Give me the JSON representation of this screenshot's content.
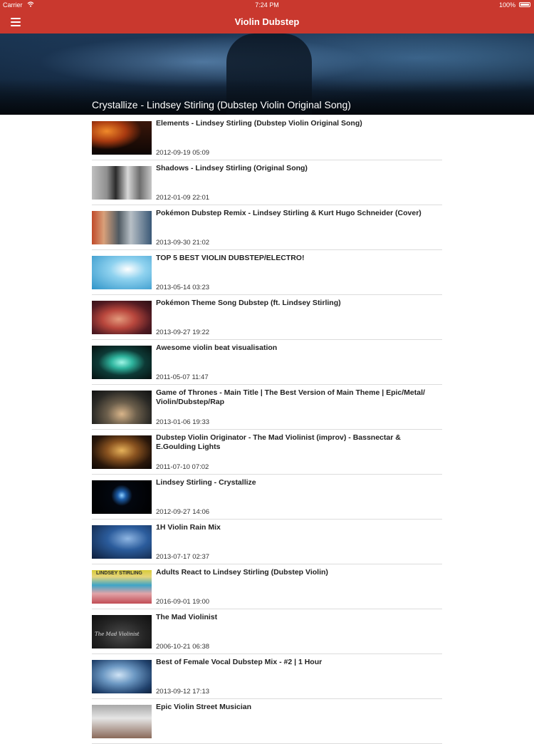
{
  "status_bar": {
    "carrier": "Carrier",
    "time": "7:24 PM",
    "battery": "100%"
  },
  "nav": {
    "title": "Violin Dubstep",
    "menu_icon": "hamburger-menu-icon"
  },
  "featured": {
    "title": "Crystallize - Lindsey Stirling (Dubstep Violin Original Song)"
  },
  "videos": [
    {
      "title": "Elements - Lindsey Stirling (Dubstep Violin Original Song)",
      "date": "2012-09-19 05:09"
    },
    {
      "title": "Shadows - Lindsey Stirling (Original Song)",
      "date": "2012-01-09 22:01"
    },
    {
      "title": "Pokémon Dubstep Remix - Lindsey Stirling & Kurt Hugo Schneider (Cover)",
      "date": "2013-09-30 21:02"
    },
    {
      "title": "TOP 5 BEST VIOLIN DUBSTEP/ELECTRO!",
      "date": "2013-05-14 03:23"
    },
    {
      "title": "Pokémon Theme Song Dubstep (ft. Lindsey Stirling)",
      "date": "2013-09-27 19:22"
    },
    {
      "title": "Awesome violin beat visualisation",
      "date": "2011-05-07 11:47"
    },
    {
      "title": "Game of Thrones - Main Title | The Best Version of Main Theme | Epic/Metal/ Violin/Dubstep/Rap",
      "date": "2013-01-06 19:33"
    },
    {
      "title": "Dubstep Violin Originator - The Mad Violinist (improv) - Bassnectar & E.Goulding Lights",
      "date": "2011-07-10 07:02"
    },
    {
      "title": "Lindsey Stirling - Crystallize",
      "date": "2012-09-27 14:06"
    },
    {
      "title": "1H Violin Rain Mix",
      "date": "2013-07-17 02:37"
    },
    {
      "title": "Adults React to Lindsey Stirling (Dubstep Violin)",
      "date": "2016-09-01 19:00"
    },
    {
      "title": "The Mad Violinist",
      "date": "2006-10-21 06:38"
    },
    {
      "title": "Best of Female Vocal Dubstep Mix - #2 | 1 Hour",
      "date": "2013-09-12 17:13"
    },
    {
      "title": "Epic Violin Street Musician",
      "date": ""
    }
  ],
  "thumb_text": {
    "adults_react": "LINDSEY STIRLING",
    "mad_violinist": "The Mad Violinist"
  },
  "colors": {
    "accent": "#c9382e",
    "divider": "#dcdcdc"
  }
}
